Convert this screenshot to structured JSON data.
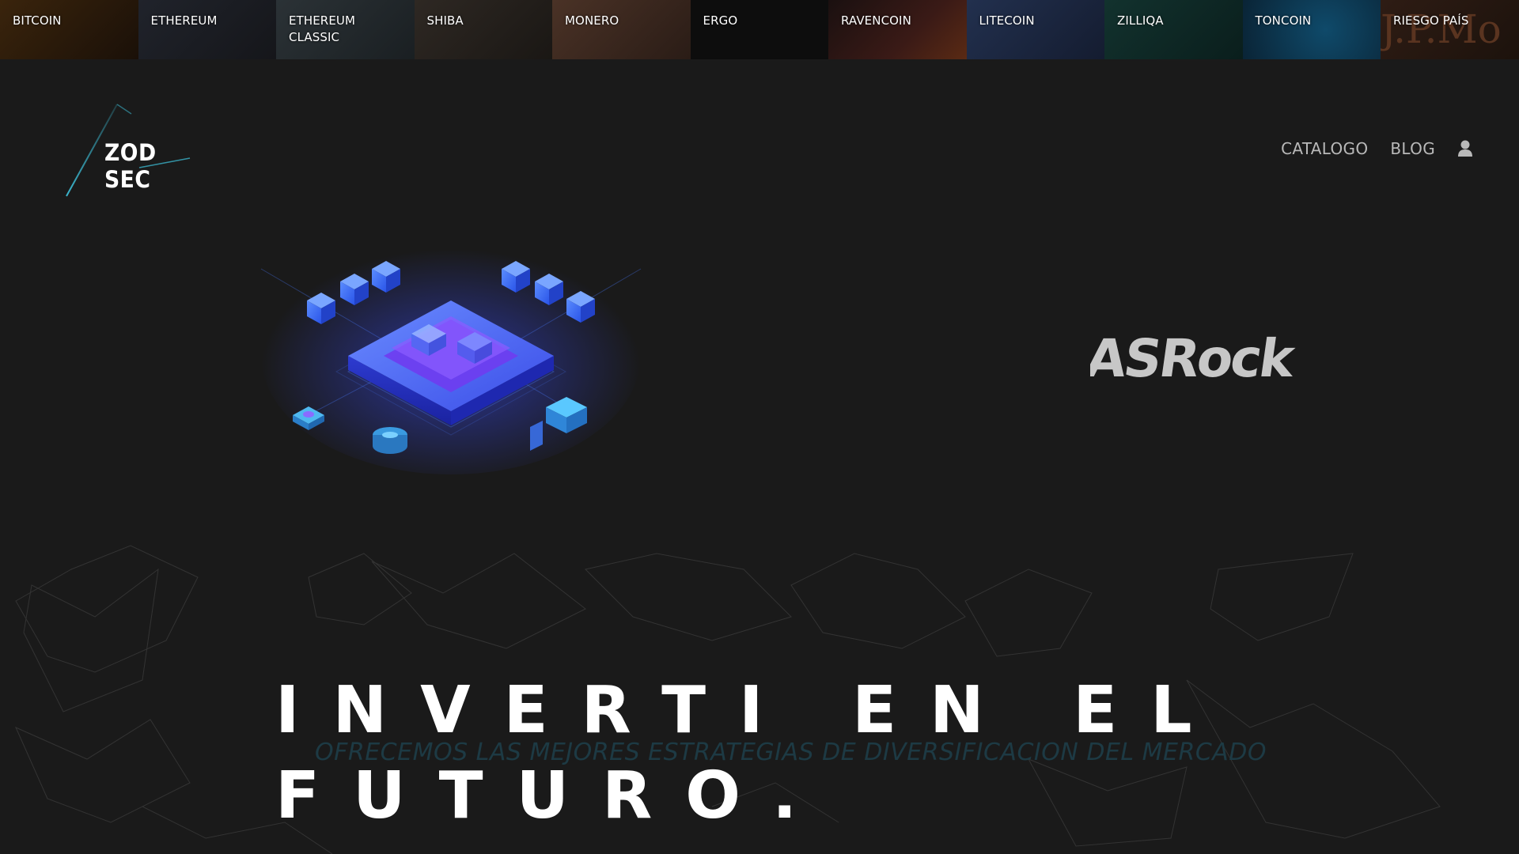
{
  "ticker": [
    {
      "label": "BITCOIN",
      "bg": "#2a1a0a"
    },
    {
      "label": "ETHEREUM",
      "bg": "#1c1e24"
    },
    {
      "label": "ETHEREUM CLASSIC",
      "bg": "#23282b"
    },
    {
      "label": "SHIBA",
      "bg": "#26221e"
    },
    {
      "label": "MONERO",
      "bg": "#3a2a22"
    },
    {
      "label": "ERGO",
      "bg": "#0d0d0d"
    },
    {
      "label": "RAVENCOIN",
      "bg": "#2a1616"
    },
    {
      "label": "LITECOIN",
      "bg": "#1e2a44"
    },
    {
      "label": "ZILLIQA",
      "bg": "#10302c"
    },
    {
      "label": "TONCOIN",
      "bg": "#0e3048"
    },
    {
      "label": "RIESGO PAÍS",
      "bg": "#2a1a12",
      "watermark": "J.P.Mo"
    }
  ],
  "logo": {
    "text": "ZOD SEC"
  },
  "nav": {
    "catalog": "CATALOGO",
    "blog": "BLOG",
    "user_icon": "user-icon"
  },
  "brand": {
    "name": "ASRock"
  },
  "hero": {
    "headline_line1": "INVERTI EN EL",
    "headline_line2": "FUTURO.",
    "subtitle": "OFRECEMOS LAS MEJORES ESTRATEGIAS DE DIVERSIFICACION DEL MERCADO"
  },
  "colors": {
    "background": "#1a1a1a",
    "accent": "#4a7bff",
    "nav_text": "#b9b9b9",
    "subtitle": "#1d3a44"
  }
}
